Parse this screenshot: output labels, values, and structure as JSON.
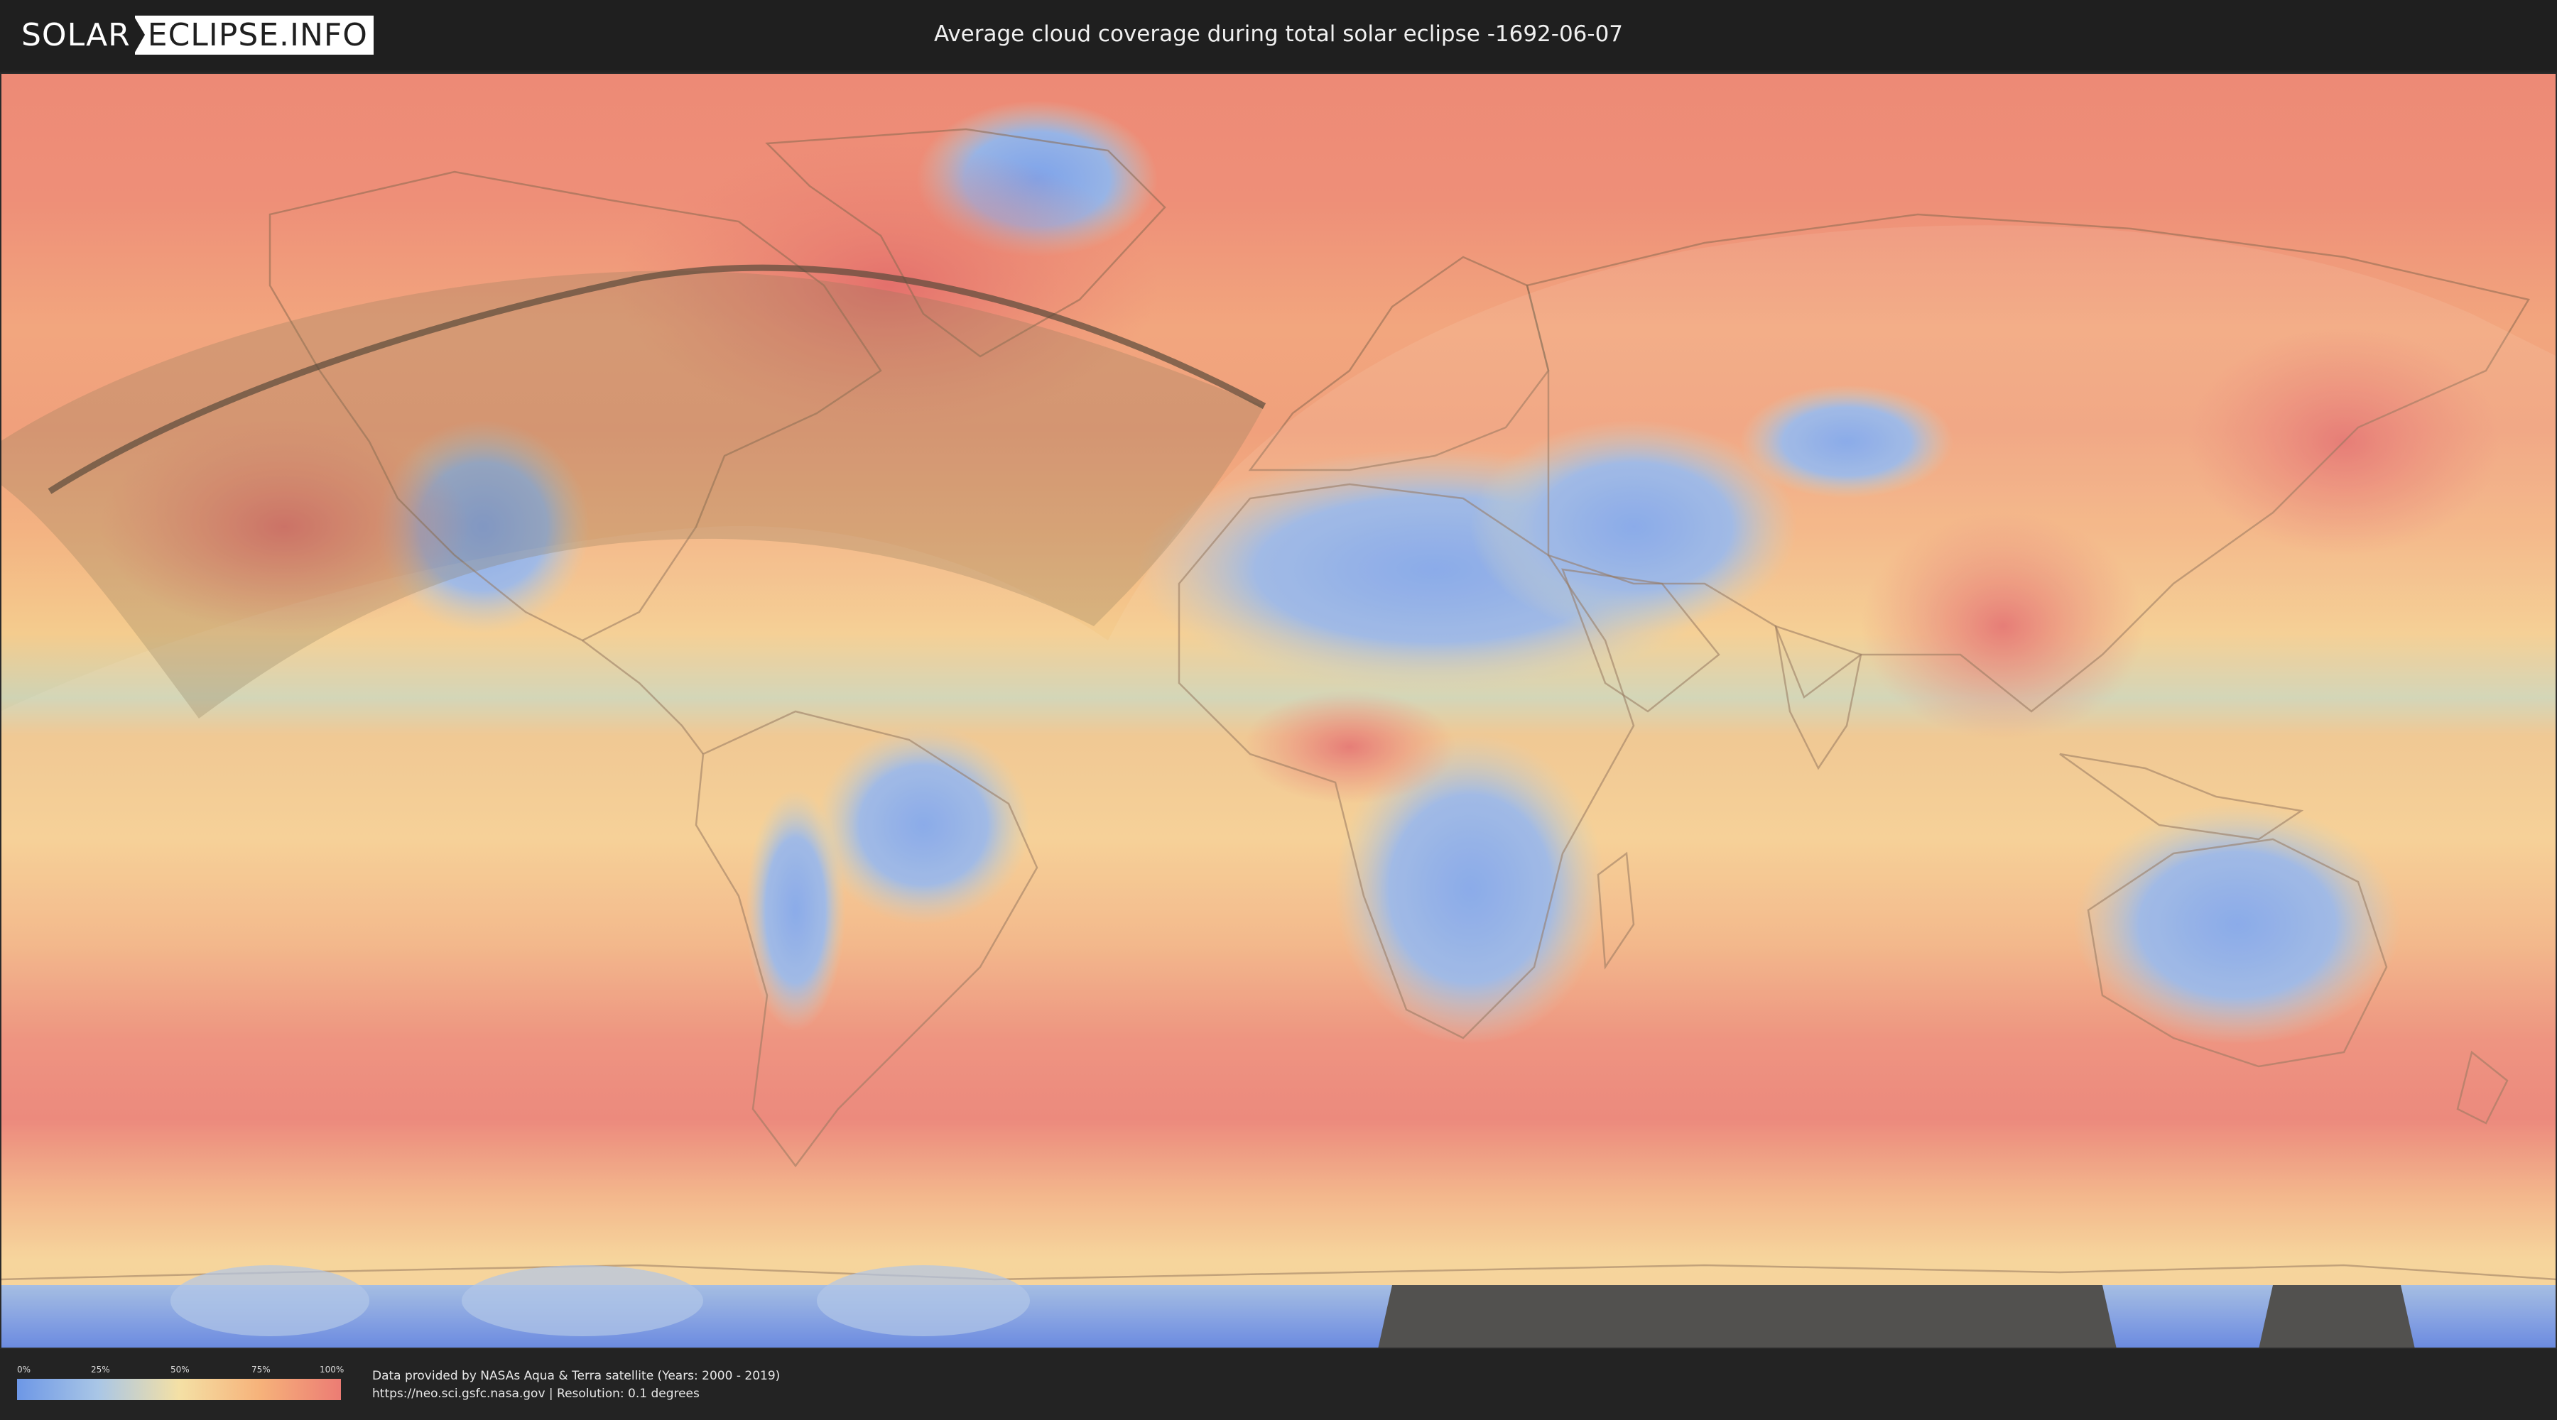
{
  "header": {
    "logo_part1": "SOLAR",
    "logo_part2": "ECLIPSE.INFO",
    "title": "Average cloud coverage during total solar eclipse -1692-06-07"
  },
  "legend": {
    "ticks": [
      "0%",
      "25%",
      "50%",
      "75%",
      "100%"
    ],
    "colors": [
      "#6d97e6",
      "#a9c6e6",
      "#f4e0a5",
      "#f6b27a",
      "#ec7c74"
    ]
  },
  "credits": {
    "line1": "Data provided by NASAs Aqua & Terra satellite (Years: 2000 - 2019)",
    "line2": "https://neo.sci.gsfc.nasa.gov | Resolution: 0.1 degrees"
  },
  "map": {
    "theme_colors": {
      "ocean_cloudy": "#ec8a74",
      "mid": "#f5c88a",
      "clear": "#8fb0ea",
      "antarctic": "#5577dd",
      "land_outline": "#8a6a50",
      "path_line": "#5a4a3a",
      "shadow_overlay": "#8c7a5a",
      "night_overlay": "#ffffff"
    }
  }
}
